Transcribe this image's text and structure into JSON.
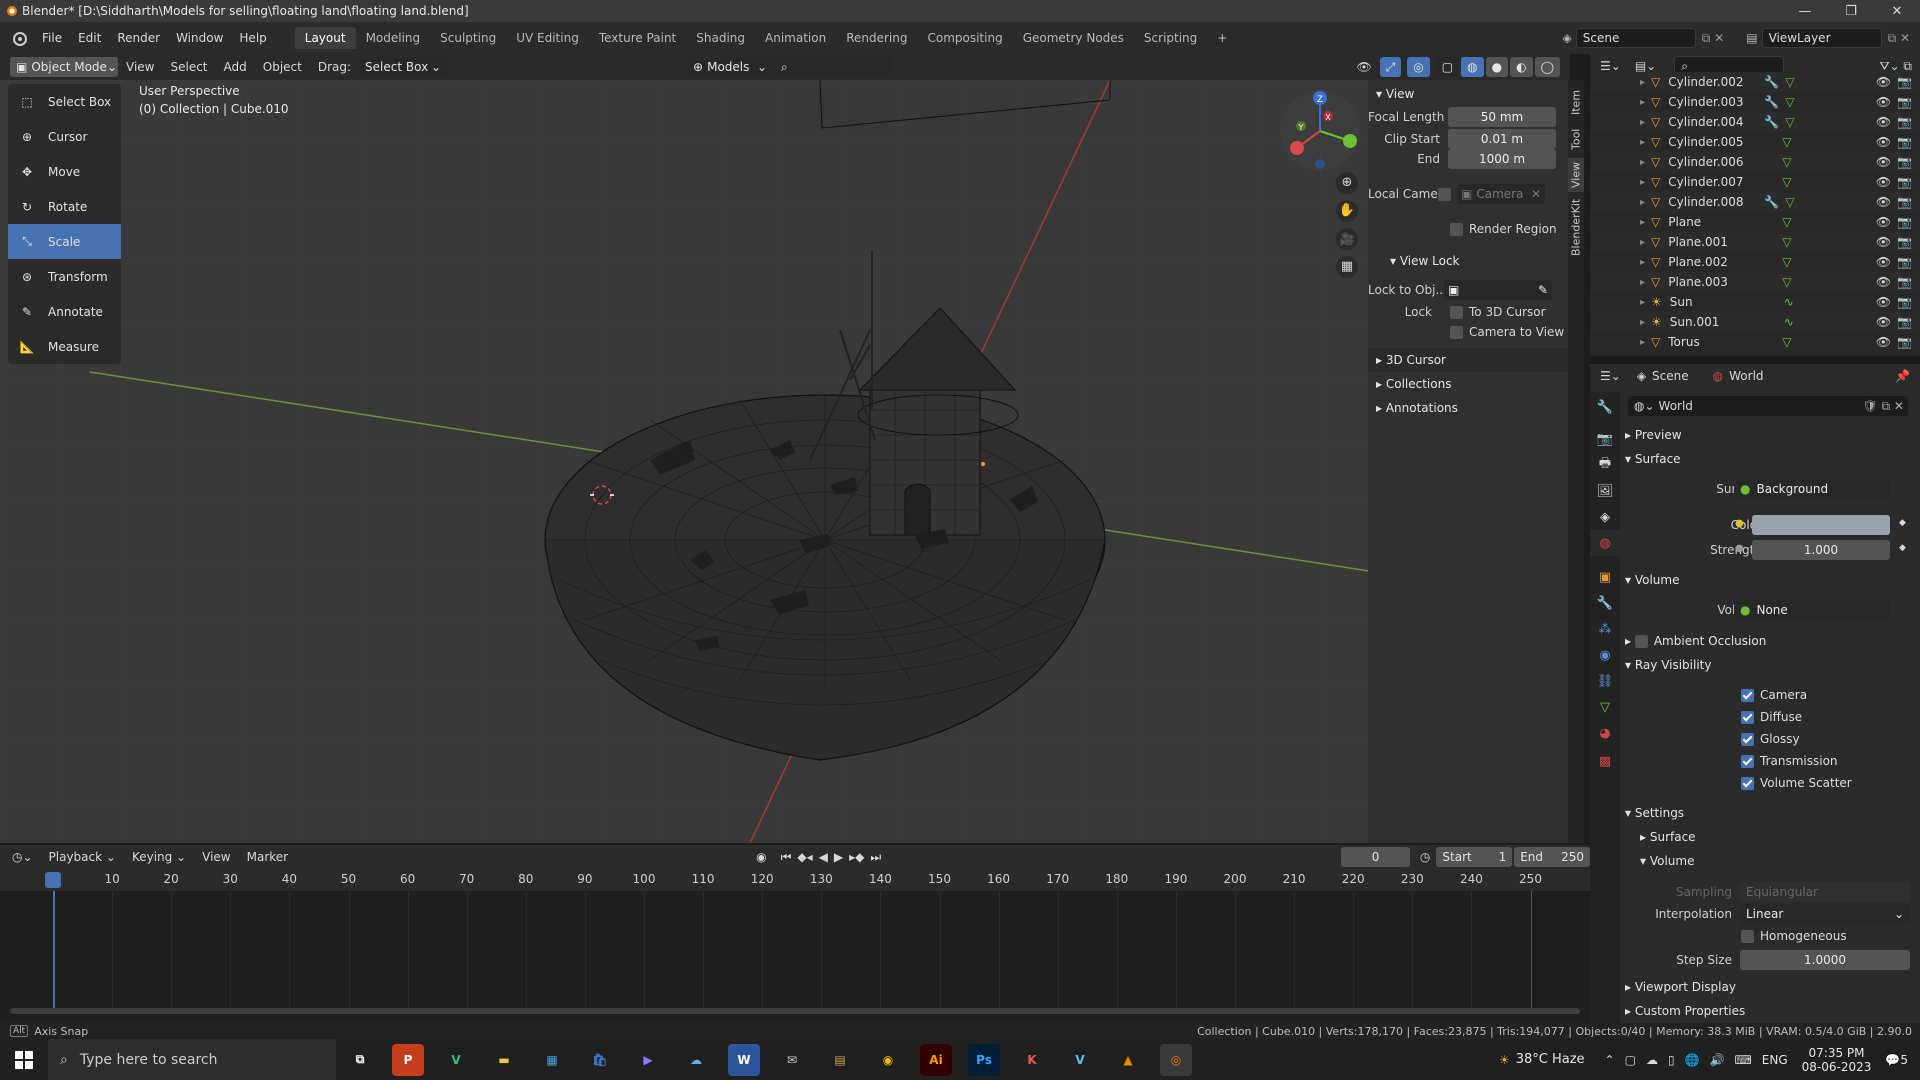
{
  "window": {
    "title": "Blender* [D:\\Siddharth\\Models for selling\\floating land\\floating land.blend]"
  },
  "menu": [
    "File",
    "Edit",
    "Render",
    "Window",
    "Help"
  ],
  "workspaces": [
    {
      "label": "Layout",
      "active": true
    },
    {
      "label": "Modeling"
    },
    {
      "label": "Sculpting"
    },
    {
      "label": "UV Editing"
    },
    {
      "label": "Texture Paint"
    },
    {
      "label": "Shading"
    },
    {
      "label": "Animation"
    },
    {
      "label": "Rendering"
    },
    {
      "label": "Compositing"
    },
    {
      "label": "Geometry Nodes"
    },
    {
      "label": "Scripting"
    }
  ],
  "topbar": {
    "scene": "Scene",
    "viewlayer": "ViewLayer",
    "add_tab": "+"
  },
  "viewport_header": {
    "mode": "Object Mode",
    "view": "View",
    "select": "Select",
    "add": "Add",
    "object": "Object",
    "drag_label": "Drag:",
    "drag_value": "Select Box",
    "models": "Models"
  },
  "viewport": {
    "perspective": "User Perspective",
    "collection": "(0) Collection | Cube.010"
  },
  "tools": [
    {
      "label": "Select Box",
      "icon": "select-box-icon"
    },
    {
      "label": "Cursor",
      "icon": "cursor-icon"
    },
    {
      "label": "Move",
      "icon": "move-icon"
    },
    {
      "label": "Rotate",
      "icon": "rotate-icon"
    },
    {
      "label": "Scale",
      "icon": "scale-icon",
      "active": true
    },
    {
      "label": "Transform",
      "icon": "transform-icon"
    },
    {
      "label": "Annotate",
      "icon": "annotate-icon"
    },
    {
      "label": "Measure",
      "icon": "measure-icon"
    }
  ],
  "npanel": {
    "view_header": "View",
    "focal_label": "Focal Length",
    "focal_value": "50 mm",
    "clip_start_label": "Clip Start",
    "clip_start_value": "0.01 m",
    "end_label": "End",
    "end_value": "1000 m",
    "local_camera_label": "Local Came...",
    "local_camera_value": "Camera",
    "render_region": "Render Region",
    "view_lock_header": "View Lock",
    "lock_obj_label": "Lock to Obj...",
    "lock_label": "Lock",
    "to_3d_cursor": "To 3D Cursor",
    "camera_to_view": "Camera to View",
    "cursor_header": "3D Cursor",
    "collections_header": "Collections",
    "annotations_header": "Annotations",
    "tabs": [
      "Item",
      "Tool",
      "View",
      "BlenderKit"
    ]
  },
  "outliner": {
    "items": [
      {
        "name": "Cylinder.002",
        "mod": true
      },
      {
        "name": "Cylinder.003",
        "mod": true
      },
      {
        "name": "Cylinder.004",
        "mod": true
      },
      {
        "name": "Cylinder.005",
        "mod": false
      },
      {
        "name": "Cylinder.006",
        "mod": false
      },
      {
        "name": "Cylinder.007",
        "mod": false
      },
      {
        "name": "Cylinder.008",
        "mod": true
      },
      {
        "name": "Plane",
        "mod": false
      },
      {
        "name": "Plane.001",
        "mod": false
      },
      {
        "name": "Plane.002",
        "mod": false
      },
      {
        "name": "Plane.003",
        "mod": false
      },
      {
        "name": "Sun",
        "mod": false,
        "light": true
      },
      {
        "name": "Sun.001",
        "mod": false,
        "light": true
      },
      {
        "name": "Torus",
        "mod": false
      }
    ]
  },
  "properties": {
    "scene_tab": "Scene",
    "world_tab": "World",
    "world_name": "World",
    "preview": "Preview",
    "surface_header": "Surface",
    "surface_label": "Surface",
    "surface_value": "Background",
    "color_label": "Color",
    "strength_label": "Strength",
    "strength_value": "1.000",
    "volume_header": "Volume",
    "volume_label": "Volume",
    "volume_value": "None",
    "ambient_occlusion": "Ambient Occlusion",
    "ray_visibility": "Ray Visibility",
    "rays": [
      "Camera",
      "Diffuse",
      "Glossy",
      "Transmission",
      "Volume Scatter"
    ],
    "settings": "Settings",
    "settings_surface": "Surface",
    "settings_volume": "Volume",
    "sampling_label": "Sampling",
    "sampling_value": "Equiangular",
    "interpolation_label": "Interpolation",
    "interpolation_value": "Linear",
    "homogeneous": "Homogeneous",
    "step_size_label": "Step Size",
    "step_size_value": "1.0000",
    "viewport_display": "Viewport Display",
    "custom_properties": "Custom Properties",
    "world_color": "#9aa3ab"
  },
  "timeline": {
    "playback": "Playback",
    "keying": "Keying",
    "view": "View",
    "marker": "Marker",
    "current_frame": "0",
    "start_label": "Start",
    "start_value": "1",
    "end_label": "End",
    "end_value": "250",
    "ticks": [
      "0",
      "10",
      "20",
      "30",
      "40",
      "50",
      "60",
      "70",
      "80",
      "90",
      "100",
      "110",
      "120",
      "130",
      "140",
      "150",
      "160",
      "170",
      "180",
      "190",
      "200",
      "210",
      "220",
      "230",
      "240",
      "250"
    ]
  },
  "statusbar": {
    "left": "Axis Snap",
    "right": "Collection | Cube.010 | Verts:178,170 | Faces:23,875 | Tris:194,077 | Objects:0/40 | Memory: 38.3 MiB | VRAM: 0.5/4.0 GiB | 2.90.0"
  },
  "taskbar": {
    "search_placeholder": "Type here to search",
    "weather": "38°C  Haze",
    "lang": "ENG",
    "time": "07:35 PM",
    "date": "08-06-2023",
    "notif": "5"
  }
}
